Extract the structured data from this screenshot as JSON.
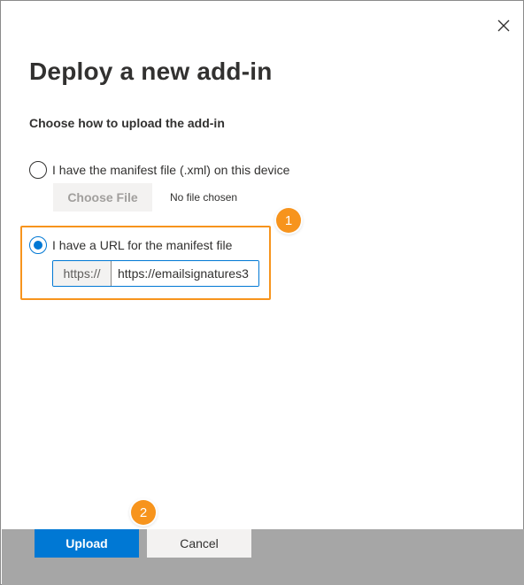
{
  "dialog": {
    "title": "Deploy a new add-in",
    "subtitle": "Choose how to upload the add-in",
    "close_icon": "close-icon"
  },
  "options": {
    "file": {
      "label": "I have the manifest file (.xml) on this device",
      "selected": false,
      "choose_button": "Choose File",
      "no_file_text": "No file chosen"
    },
    "url": {
      "label": "I have a URL for the manifest file",
      "selected": true,
      "prefix": "https://",
      "value": "https://emailsignatures3"
    }
  },
  "annotations": {
    "badge_1": "1",
    "badge_2": "2",
    "color": "#f7941d"
  },
  "footer": {
    "upload_label": "Upload",
    "cancel_label": "Cancel"
  },
  "colors": {
    "accent": "#0078d4",
    "footer_bg": "#a6a6a6"
  }
}
